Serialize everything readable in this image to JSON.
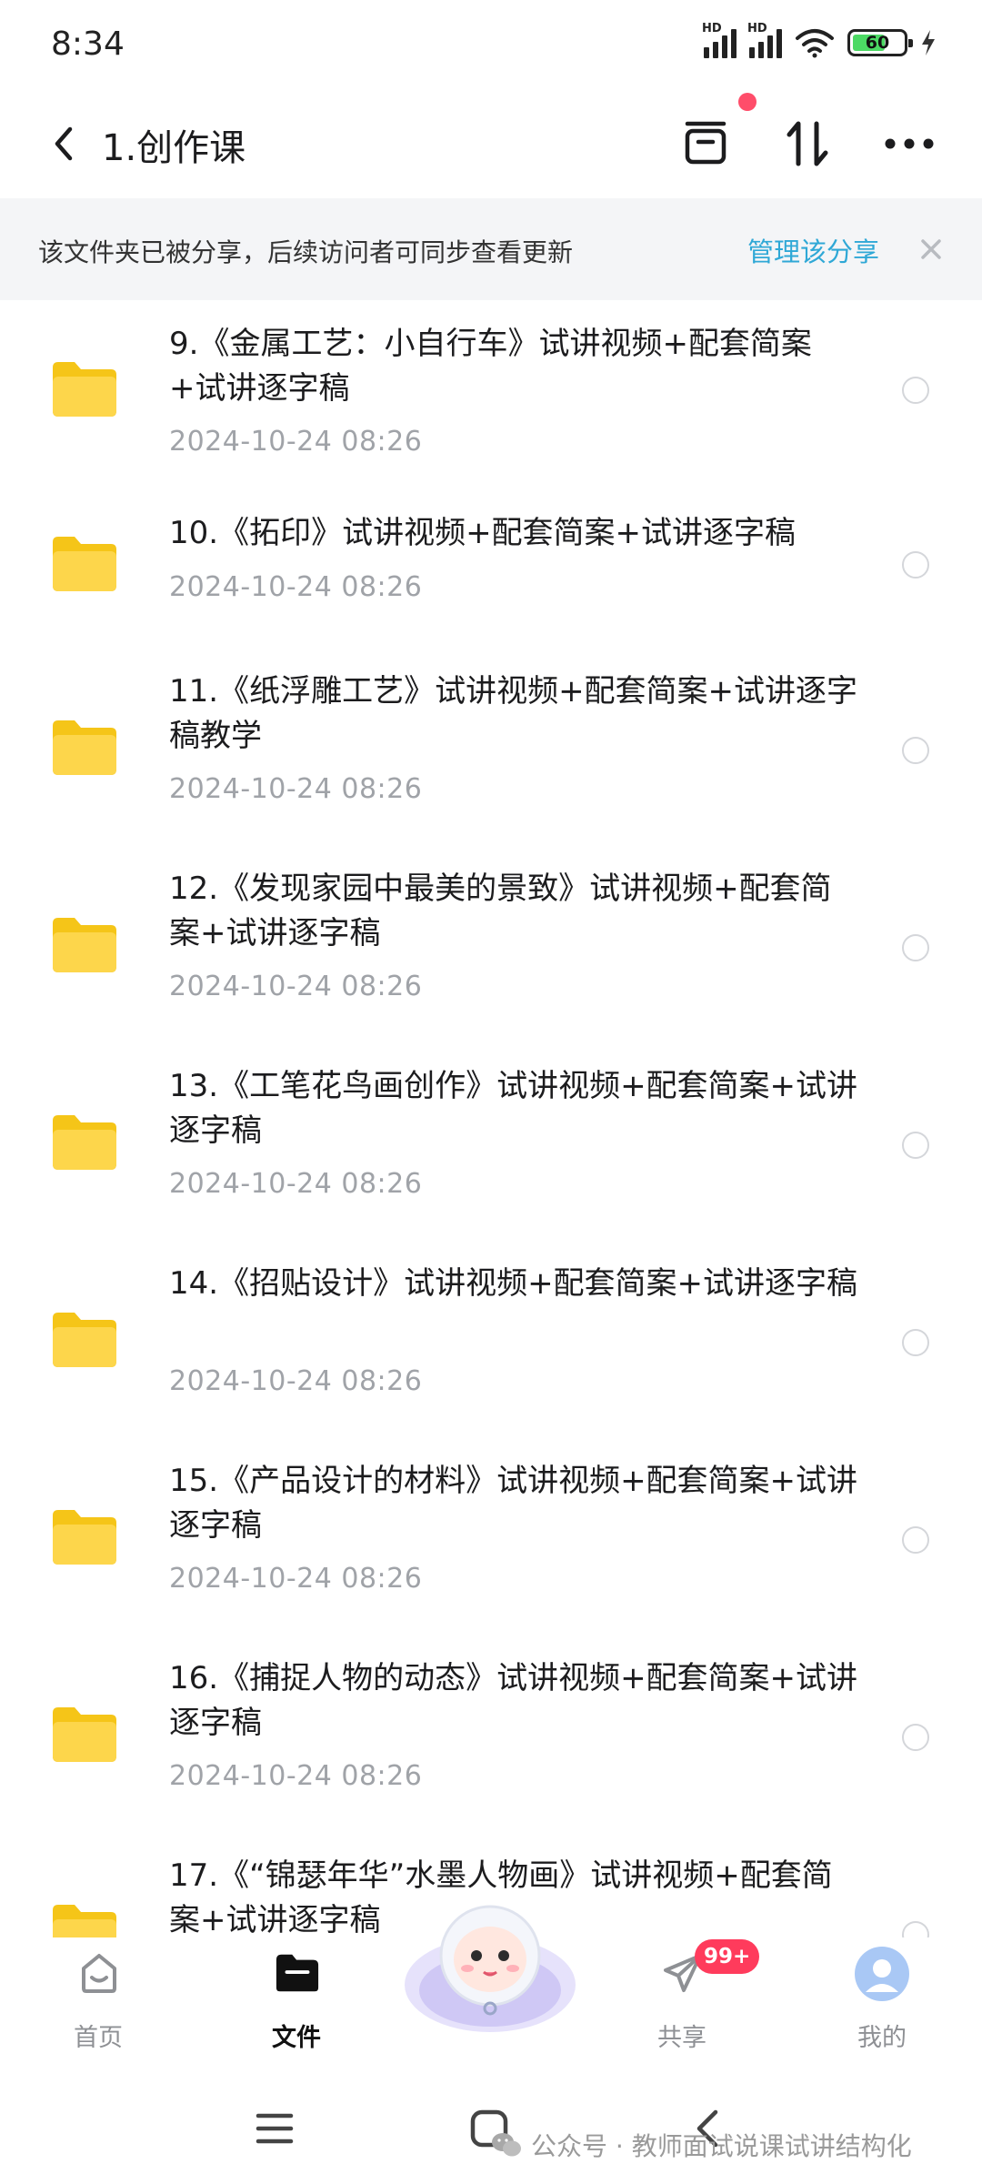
{
  "status_bar": {
    "time": "8:34",
    "network_1": "HD",
    "network_2": "HD",
    "battery": "60"
  },
  "nav": {
    "title": "1.创作课",
    "icons": [
      "back-icon",
      "tray-icon",
      "sort-icon",
      "more-icon"
    ]
  },
  "share_banner": {
    "text": "该文件夹已被分享，后续访问者可同步查看更新",
    "manage_label": "管理该分享",
    "accent_color": "#2fa8d6"
  },
  "files": [
    {
      "title": "9.《金属工艺：小自行车》试讲视频+配套简案+试讲逐字稿",
      "date": "2024-10-24  08:26"
    },
    {
      "title": "10.《拓印》试讲视频+配套简案+试讲逐字稿",
      "date": "2024-10-24  08:26"
    },
    {
      "title": "11.《纸浮雕工艺》试讲视频+配套简案+试讲逐字稿教学",
      "date": "2024-10-24  08:26"
    },
    {
      "title": "12.《发现家园中最美的景致》试讲视频+配套简案+试讲逐字稿",
      "date": "2024-10-24  08:26"
    },
    {
      "title": "13.《工笔花鸟画创作》试讲视频+配套简案+试讲逐字稿",
      "date": "2024-10-24  08:26"
    },
    {
      "title": "14.《招贴设计》试讲视频+配套简案+试讲逐字稿",
      "date": "2024-10-24  08:26"
    },
    {
      "title": "15.《产品设计的材料》试讲视频+配套简案+试讲逐字稿",
      "date": "2024-10-24  08:26"
    },
    {
      "title": "16.《捕捉人物的动态》试讲视频+配套简案+试讲逐字稿",
      "date": "2024-10-24  08:26"
    },
    {
      "title": "17.《“锦瑟年华”水墨人物画》试讲视频+配套简案+试讲逐字稿",
      "date": ""
    }
  ],
  "tabs": [
    {
      "label": "首页",
      "icon": "home-icon",
      "active": false
    },
    {
      "label": "文件",
      "icon": "folder-tab-icon",
      "active": true
    },
    {
      "label": "共享",
      "icon": "send-icon",
      "active": false
    },
    {
      "label": "我的",
      "icon": "avatar-icon",
      "active": false
    }
  ],
  "share_badge": "99+",
  "watermark": "公众号 · 教师面试说课试讲结构化"
}
